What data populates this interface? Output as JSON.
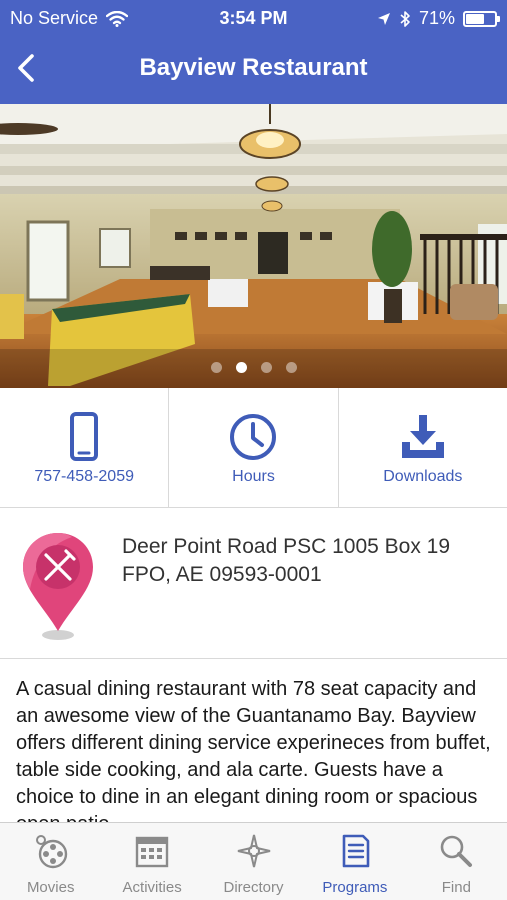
{
  "status_bar": {
    "carrier": "No Service",
    "time": "3:54 PM",
    "battery": "71%",
    "battery_level": 0.71,
    "icons": [
      "wifi-icon",
      "location-arrow-icon",
      "bluetooth-icon",
      "battery-icon"
    ]
  },
  "nav": {
    "title": "Bayview Restaurant",
    "back_icon": "chevron-left-icon"
  },
  "gallery": {
    "page_count": 4,
    "current_page": 2
  },
  "actions": [
    {
      "label": "757-458-2059",
      "icon": "phone-icon"
    },
    {
      "label": "Hours",
      "icon": "clock-icon"
    },
    {
      "label": "Downloads",
      "icon": "download-icon"
    }
  ],
  "address": {
    "line1": "Deer Point Road  PSC 1005 Box 19",
    "line2": "FPO, AE 09593-0001",
    "pin_icon": "restaurant-map-pin-icon"
  },
  "description": "A casual dining restaurant with 78 seat capacity and an awesome view of the Guantanamo Bay. Bayview offers different dining service experineces from buffet, table side cooking, and ala carte. Guests have a choice to dine in an elegant dining room or spacious open patio.",
  "tabs": [
    {
      "label": "Movies",
      "icon": "film-reel-icon",
      "active": false
    },
    {
      "label": "Activities",
      "icon": "calendar-icon",
      "active": false
    },
    {
      "label": "Directory",
      "icon": "compass-icon",
      "active": false
    },
    {
      "label": "Programs",
      "icon": "document-icon",
      "active": true
    },
    {
      "label": "Find",
      "icon": "search-icon",
      "active": false
    }
  ],
  "colors": {
    "header": "#4a63c4",
    "accent": "#3f5cb8",
    "pin": "#e0457b",
    "inactive_tab": "#8a8a8a"
  }
}
